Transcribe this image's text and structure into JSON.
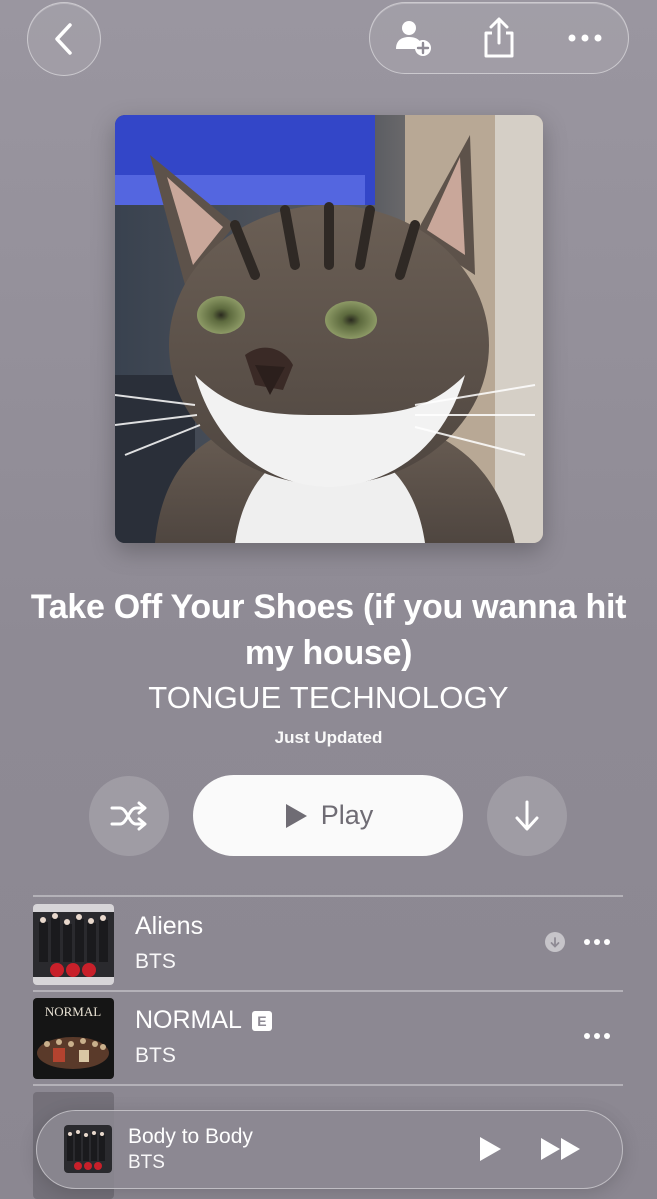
{
  "header": {
    "back_icon": "chevron-left-icon",
    "actions": [
      "add-person-icon",
      "share-icon",
      "more-icon"
    ]
  },
  "playlist": {
    "title": "Take Off Your Shoes (if you wanna hit my house)",
    "curator": "TONGUE TECHNOLOGY",
    "status": "Just Updated",
    "artwork_icon": "cat-photo"
  },
  "controls": {
    "shuffle_icon": "shuffle-icon",
    "play_label": "Play",
    "download_icon": "download-arrow-icon"
  },
  "tracks": [
    {
      "name": "Aliens",
      "artist": "BTS",
      "explicit": false,
      "downloaded_indicator": true
    },
    {
      "name": "NORMAL",
      "artist": "BTS",
      "explicit": true,
      "explicit_label": "E",
      "cover_text": "NORMAL"
    }
  ],
  "now_playing": {
    "title": "Body to Body",
    "artist": "BTS"
  },
  "colors": {
    "background": "#948f99",
    "play_button_bg": "#fafafa",
    "play_button_text": "#6f6c74"
  }
}
